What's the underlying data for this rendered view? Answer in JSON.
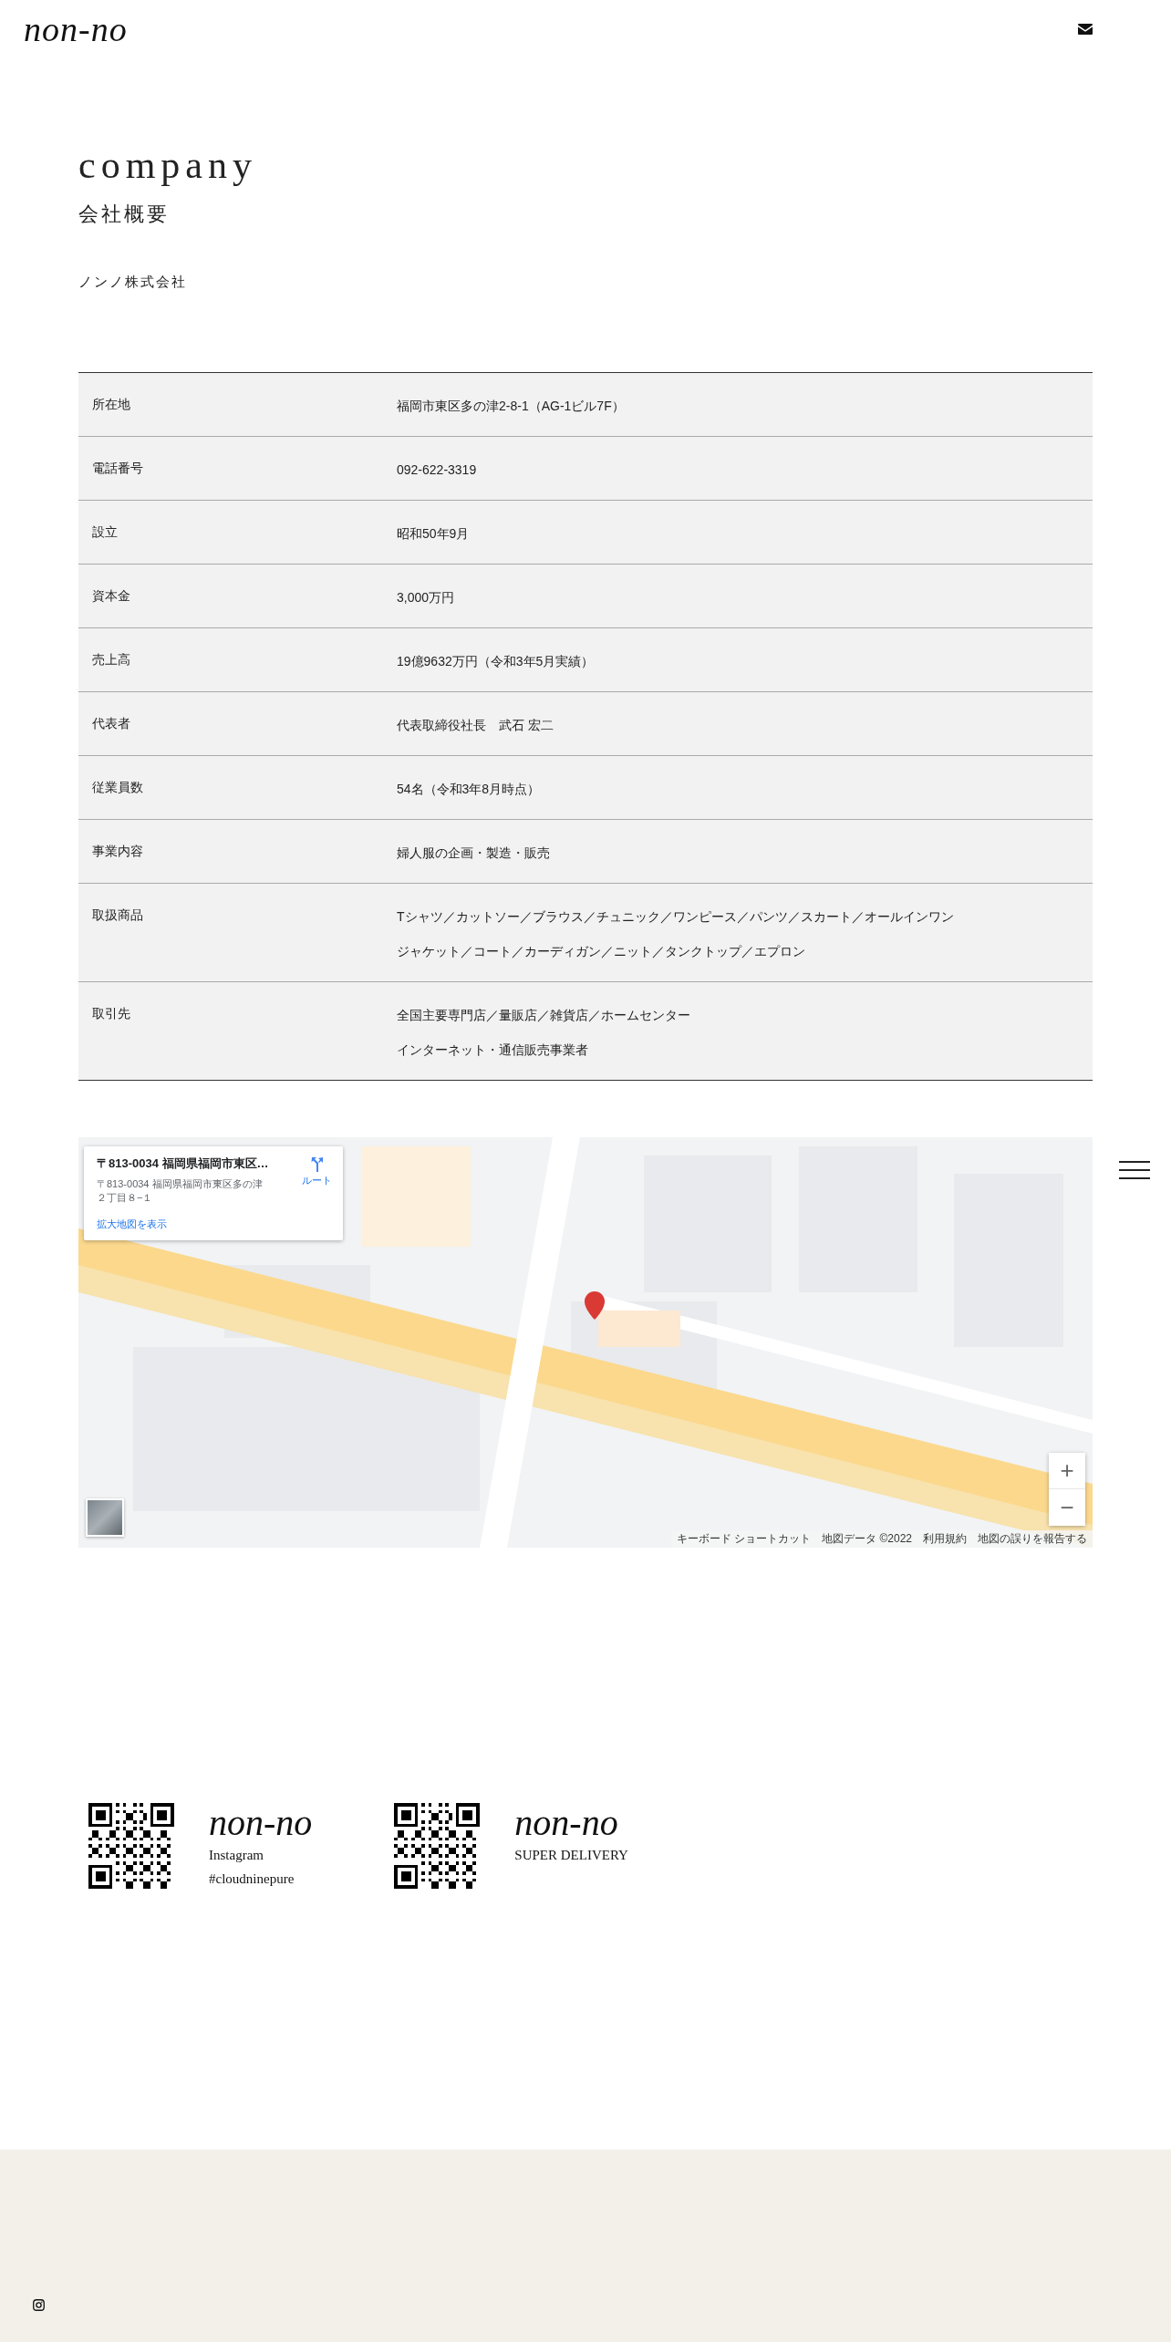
{
  "header": {
    "logo": "non-no"
  },
  "heading": {
    "title": "company",
    "subtitle": "会社概要"
  },
  "company_name": "ノンノ株式会社",
  "table": {
    "rows": [
      {
        "label": "所在地",
        "lines": [
          "福岡市東区多の津2-8-1（AG-1ビル7F）"
        ]
      },
      {
        "label": "電話番号",
        "lines": [
          "092-622-3319"
        ]
      },
      {
        "label": "設立",
        "lines": [
          "昭和50年9月"
        ]
      },
      {
        "label": "資本金",
        "lines": [
          "3,000万円"
        ]
      },
      {
        "label": "売上高",
        "lines": [
          "19億9632万円（令和3年5月実績）"
        ]
      },
      {
        "label": "代表者",
        "lines": [
          "代表取締役社長　武石 宏二"
        ]
      },
      {
        "label": "従業員数",
        "lines": [
          "54名（令和3年8月時点）"
        ]
      },
      {
        "label": "事業内容",
        "lines": [
          "婦人服の企画・製造・販売"
        ]
      },
      {
        "label": "取扱商品",
        "lines": [
          "Tシャツ／カットソー／ブラウス／チュニック／ワンピース／パンツ／スカート／オールインワン",
          "ジャケット／コート／カーディガン／ニット／タンクトップ／エプロン"
        ]
      },
      {
        "label": "取引先",
        "lines": [
          "全国主要専門店／量販店／雑貨店／ホームセンター",
          "インターネット・通信販売事業者"
        ]
      }
    ]
  },
  "map": {
    "kind": "picture",
    "info_card": {
      "title": "〒813-0034 福岡県福岡市東区…",
      "address_lines": [
        "〒813-0034 福岡県福岡市東区多の津",
        "２丁目８−１"
      ],
      "route": "ルート",
      "link": "拡大地図を表示"
    },
    "zoom_in": "+",
    "zoom_out": "−",
    "attribution": [
      "キーボード ショートカット",
      "地図データ ©2022",
      "利用規約",
      "地図の誤りを報告する"
    ]
  },
  "footer_links": [
    {
      "logo": "non-no",
      "lines": [
        "Instagram",
        "#cloudninepure"
      ]
    },
    {
      "logo": "non-no",
      "lines": [
        "SUPER DELIVERY"
      ]
    }
  ]
}
